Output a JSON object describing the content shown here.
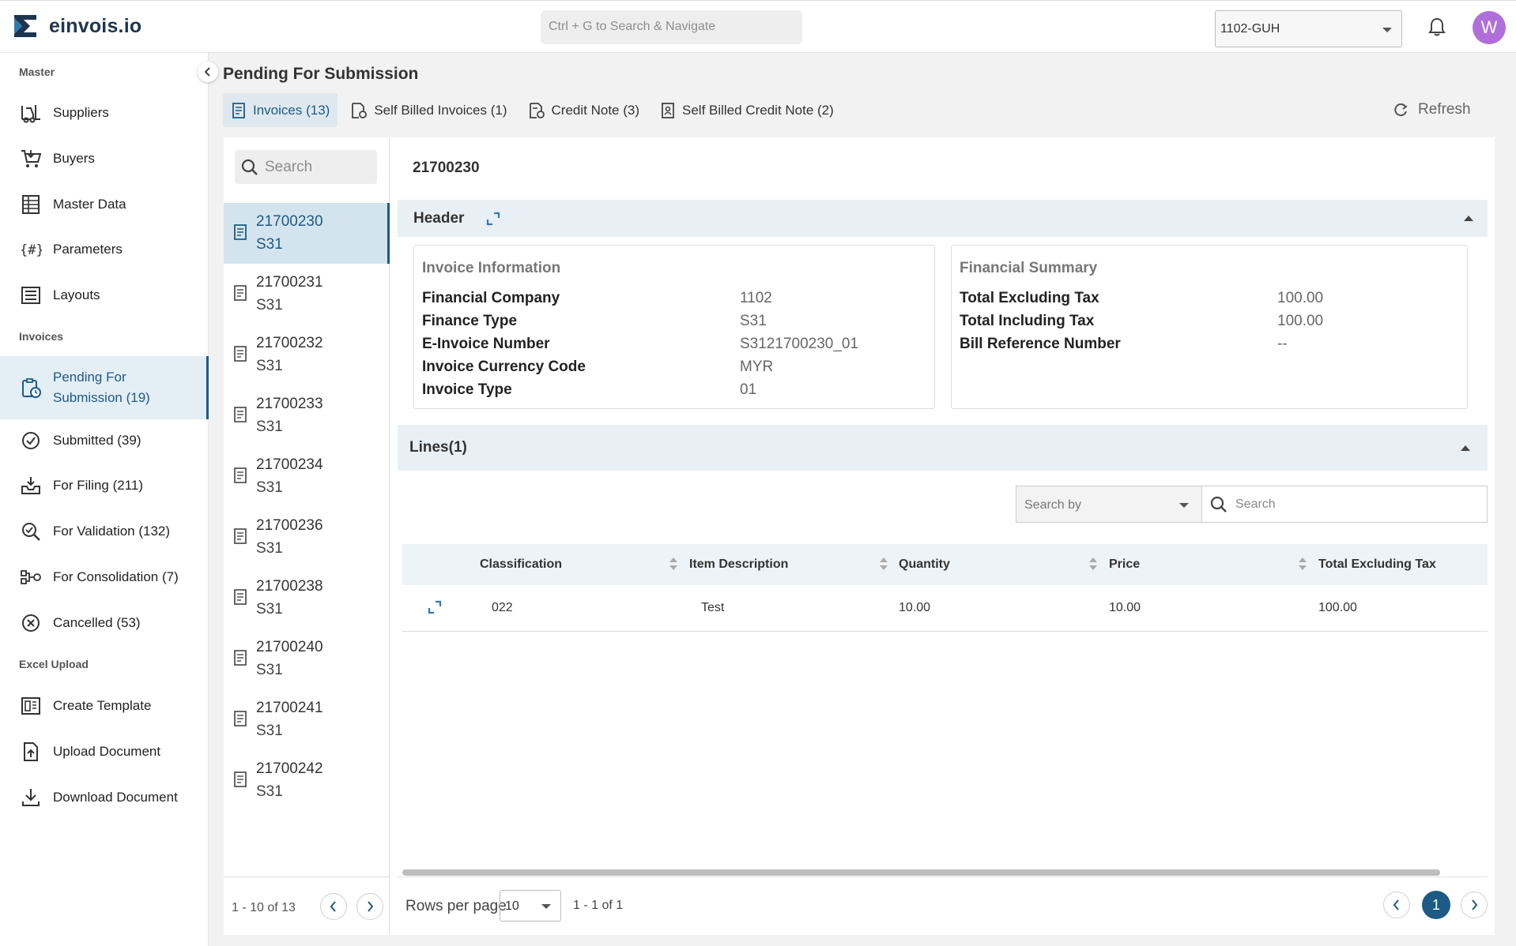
{
  "app": {
    "name": "einvois.io"
  },
  "topbar": {
    "search_placeholder": "Ctrl + G to Search & Navigate",
    "company": "1102-GUH",
    "avatar_initial": "W"
  },
  "sidebar": {
    "sections": {
      "master": "Master",
      "invoices": "Invoices",
      "excel": "Excel Upload"
    },
    "master_items": [
      {
        "label": "Suppliers",
        "icon": "forklift-icon"
      },
      {
        "label": "Buyers",
        "icon": "cart-icon"
      },
      {
        "label": "Master Data",
        "icon": "table-icon"
      },
      {
        "label": "Parameters",
        "icon": "hash-braces-icon"
      },
      {
        "label": "Layouts",
        "icon": "layout-icon"
      }
    ],
    "invoice_items": [
      {
        "label": "Pending For Submission (19)",
        "icon": "clipboard-clock-icon",
        "active": true
      },
      {
        "label": "Submitted (39)",
        "icon": "check-circle-icon"
      },
      {
        "label": "For Filing (211)",
        "icon": "inbox-download-icon"
      },
      {
        "label": "For Validation (132)",
        "icon": "search-check-icon"
      },
      {
        "label": "For Consolidation (7)",
        "icon": "merge-icon"
      },
      {
        "label": "Cancelled (53)",
        "icon": "x-circle-icon"
      }
    ],
    "excel_items": [
      {
        "label": "Create Template",
        "icon": "template-icon"
      },
      {
        "label": "Upload Document",
        "icon": "upload-file-icon"
      },
      {
        "label": "Download Document",
        "icon": "download-icon"
      }
    ]
  },
  "main": {
    "page_title": "Pending For Submission",
    "tabs": [
      {
        "label": "Invoices (13)",
        "active": true
      },
      {
        "label": "Self Billed Invoices (1)"
      },
      {
        "label": "Credit Note (3)"
      },
      {
        "label": "Self Billed Credit Note (2)"
      }
    ],
    "refresh_label": "Refresh"
  },
  "list": {
    "search_placeholder": "Search",
    "items": [
      {
        "number": "21700230",
        "type": "S31",
        "active": true
      },
      {
        "number": "21700231",
        "type": "S31"
      },
      {
        "number": "21700232",
        "type": "S31"
      },
      {
        "number": "21700233",
        "type": "S31"
      },
      {
        "number": "21700234",
        "type": "S31"
      },
      {
        "number": "21700236",
        "type": "S31"
      },
      {
        "number": "21700238",
        "type": "S31"
      },
      {
        "number": "21700240",
        "type": "S31"
      },
      {
        "number": "21700241",
        "type": "S31"
      },
      {
        "number": "21700242",
        "type": "S31"
      }
    ],
    "range": "1 - 10 of 13"
  },
  "detail": {
    "title": "21700230",
    "header_label": "Header",
    "invoice_info": {
      "title": "Invoice Information",
      "rows": [
        {
          "key": "Financial Company",
          "value": "1102"
        },
        {
          "key": "Finance Type",
          "value": "S31"
        },
        {
          "key": "E-Invoice Number",
          "value": "S3121700230_01"
        },
        {
          "key": "Invoice Currency Code",
          "value": "MYR"
        },
        {
          "key": "Invoice Type",
          "value": "01"
        }
      ]
    },
    "financial_summary": {
      "title": "Financial Summary",
      "rows": [
        {
          "key": "Total Excluding Tax",
          "value": "100.00"
        },
        {
          "key": "Total Including Tax",
          "value": "100.00"
        },
        {
          "key": "Bill Reference Number",
          "value": "--"
        }
      ]
    },
    "lines_label": "Lines(1)",
    "search_by_placeholder": "Search by",
    "search_placeholder": "Search",
    "columns": [
      "Classification",
      "Item Description",
      "Quantity",
      "Price",
      "Total Excluding Tax"
    ],
    "rows": [
      {
        "classification": "022",
        "description": "Test",
        "quantity": "10.00",
        "price": "10.00",
        "total": "100.00"
      }
    ],
    "pager": {
      "rows_per_page_label": "Rows per page",
      "rows_per_page": "10",
      "range": "1 - 1 of 1",
      "current_page": "1"
    }
  }
}
